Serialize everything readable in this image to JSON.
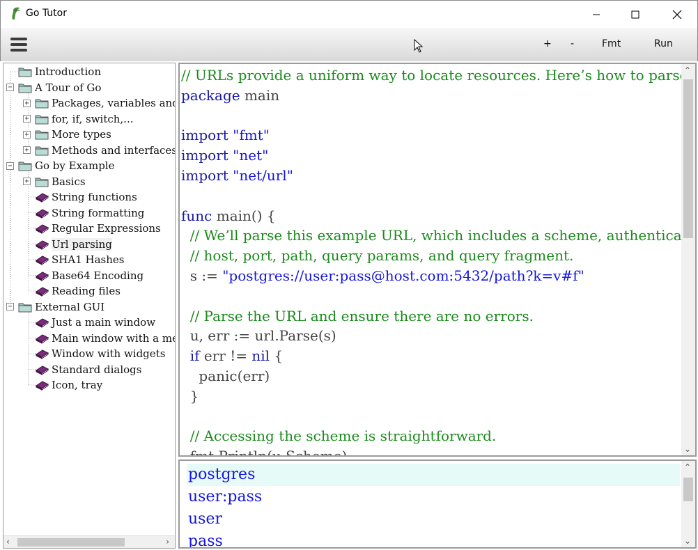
{
  "window": {
    "title": "Go Tutor"
  },
  "toolbar": {
    "plus": "+",
    "minus": "-",
    "fmt": "Fmt",
    "run": "Run"
  },
  "tree": [
    {
      "label": "Introduction",
      "level": 0,
      "kind": "folder",
      "expander": ""
    },
    {
      "label": "A Tour of Go",
      "level": 0,
      "kind": "folder",
      "expander": "−"
    },
    {
      "label": "Packages, variables and",
      "level": 1,
      "kind": "folder",
      "expander": "+"
    },
    {
      "label": "for, if, switch,...",
      "level": 1,
      "kind": "folder",
      "expander": "+"
    },
    {
      "label": "More types",
      "level": 1,
      "kind": "folder",
      "expander": "+"
    },
    {
      "label": "Methods and interfaces",
      "level": 1,
      "kind": "folder",
      "expander": "+"
    },
    {
      "label": "Go by Example",
      "level": 0,
      "kind": "folder",
      "expander": "−"
    },
    {
      "label": "Basics",
      "level": 1,
      "kind": "folder",
      "expander": "+"
    },
    {
      "label": "String functions",
      "level": 1,
      "kind": "book",
      "expander": ""
    },
    {
      "label": "String formatting",
      "level": 1,
      "kind": "book",
      "expander": ""
    },
    {
      "label": "Regular Expressions",
      "level": 1,
      "kind": "book",
      "expander": ""
    },
    {
      "label": "Url parsing",
      "level": 1,
      "kind": "book",
      "expander": "",
      "selected": true
    },
    {
      "label": "SHA1 Hashes",
      "level": 1,
      "kind": "book",
      "expander": ""
    },
    {
      "label": "Base64 Encoding",
      "level": 1,
      "kind": "book",
      "expander": ""
    },
    {
      "label": "Reading files",
      "level": 1,
      "kind": "book",
      "expander": ""
    },
    {
      "label": "External GUI",
      "level": 0,
      "kind": "folder",
      "expander": "−"
    },
    {
      "label": "Just a main window",
      "level": 1,
      "kind": "book",
      "expander": ""
    },
    {
      "label": "Main window with a me",
      "level": 1,
      "kind": "book",
      "expander": ""
    },
    {
      "label": "Window with widgets",
      "level": 1,
      "kind": "book",
      "expander": ""
    },
    {
      "label": "Standard dialogs",
      "level": 1,
      "kind": "book",
      "expander": ""
    },
    {
      "label": "Icon, tray",
      "level": 1,
      "kind": "book",
      "expander": ""
    }
  ],
  "code": [
    [
      [
        "cm",
        "// URLs provide a uniform way to locate resources. Here’s how to parse"
      ]
    ],
    [
      [
        "kw",
        "package"
      ],
      [
        "pl",
        " main"
      ]
    ],
    [],
    [
      [
        "kw",
        "import"
      ],
      [
        "pl",
        " "
      ],
      [
        "str",
        "\"fmt\""
      ]
    ],
    [
      [
        "kw",
        "import"
      ],
      [
        "pl",
        " "
      ],
      [
        "str",
        "\"net\""
      ]
    ],
    [
      [
        "kw",
        "import"
      ],
      [
        "pl",
        " "
      ],
      [
        "str",
        "\"net/url\""
      ]
    ],
    [],
    [
      [
        "kw",
        "func"
      ],
      [
        "pl",
        " main() {"
      ]
    ],
    [
      [
        "pl",
        "  "
      ],
      [
        "cm",
        "// We’ll parse this example URL, which includes a scheme, authentica"
      ]
    ],
    [
      [
        "pl",
        "  "
      ],
      [
        "cm",
        "// host, port, path, query params, and query fragment."
      ]
    ],
    [
      [
        "pl",
        "  s := "
      ],
      [
        "str",
        "\"postgres://user:pass@host.com:5432/path?k=v#f\""
      ]
    ],
    [],
    [
      [
        "pl",
        "  "
      ],
      [
        "cm",
        "// Parse the URL and ensure there are no errors."
      ]
    ],
    [
      [
        "pl",
        "  u, err := url.Parse(s)"
      ]
    ],
    [
      [
        "pl",
        "  "
      ],
      [
        "kw",
        "if"
      ],
      [
        "pl",
        " err != "
      ],
      [
        "kw",
        "nil"
      ],
      [
        "pl",
        " {"
      ]
    ],
    [
      [
        "pl",
        "    panic(err)"
      ]
    ],
    [
      [
        "pl",
        "  }"
      ]
    ],
    [],
    [
      [
        "pl",
        "  "
      ],
      [
        "cm",
        "// Accessing the scheme is straightforward."
      ]
    ],
    [
      [
        "pl",
        "  fmt.Println(u.Scheme)"
      ]
    ]
  ],
  "output": [
    "postgres",
    "user:pass",
    "user",
    "pass"
  ],
  "colors": {
    "keyword": "#1a1aa6",
    "string": "#1515e0",
    "comment": "#1b8a1b",
    "plain": "#444444",
    "output": "#1515e0",
    "output_highlight": "#e6fbf8"
  }
}
